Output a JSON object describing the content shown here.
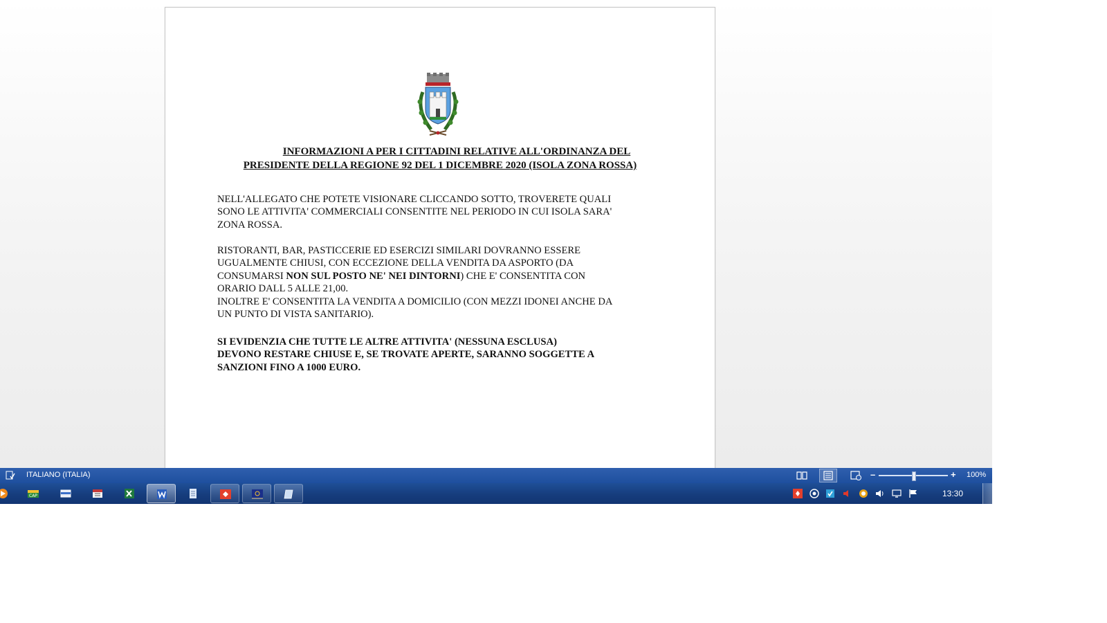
{
  "document": {
    "title_line1": "INFORMAZIONI A PER I CITTADINI RELATIVE ALL'ORDINANZA DEL",
    "title_line2": "PRESIDENTE DELLA REGIONE 92 DEL 1 DICEMBRE 2020 (ISOLA ZONA ROSSA)",
    "p1": [
      "NELL'ALLEGATO CHE POTETE VISIONARE CLICCANDO SOTTO, TROVERETE QUALI",
      "SONO LE ATTIVITA' COMMERCIALI CONSENTITE NEL PERIODO IN CUI ISOLA SARA'",
      "ZONA ROSSA."
    ],
    "p2_line1": "RISTORANTI, BAR, PASTICCERIE ED ESERCIZI SIMILARI DOVRANNO ESSERE",
    "p2_line2": "UGUALMENTE CHIUSI, CON ECCEZIONE DELLA VENDITA DA ASPORTO (DA",
    "p2_line3_pre": "CONSUMARSI ",
    "p2_line3_bold": "NON SUL POSTO NE' NEI DINTORNI",
    "p2_line3_post": ") CHE E' CONSENTITA CON",
    "p2_line4": "ORARIO DALL 5 ALLE 21,00.",
    "p2_line5": "INOLTRE E' CONSENTITA LA VENDITA A DOMICILIO (CON MEZZI IDONEI ANCHE DA",
    "p2_line6": "UN PUNTO DI VISTA SANITARIO).",
    "p3": [
      "SI EVIDENZIA CHE TUTTE LE ALTRE ATTIVITA' (NESSUNA ESCLUSA)",
      "DEVONO RESTARE CHIUSE E, SE TROVATE APERTE, SARANNO SOGGETTE A",
      "SANZIONI FINO A 1000 EURO."
    ]
  },
  "statusbar": {
    "language": "ITALIANO (ITALIA)",
    "zoom_level": "100%",
    "zoom_minus": "–",
    "zoom_plus": "+"
  },
  "taskbar": {
    "clock": "13:30",
    "apps": [
      "media-player-icon",
      "cap-app-icon",
      "window-app-icon",
      "calendar-app-icon",
      "excel-icon",
      "word-icon",
      "notepad-icon",
      "anydesk-icon",
      "flag-app-icon",
      "paper-app-icon"
    ],
    "tray": [
      "anydesk-tray-icon",
      "clock-tray-icon",
      "security-tray-icon",
      "mute-tray-icon",
      "network-globe-icon",
      "volume-icon",
      "display-icon",
      "action-center-flag-icon"
    ]
  },
  "colors": {
    "statusbar": "#2355a3",
    "taskbar": "#163d7d",
    "page": "#ffffff"
  }
}
